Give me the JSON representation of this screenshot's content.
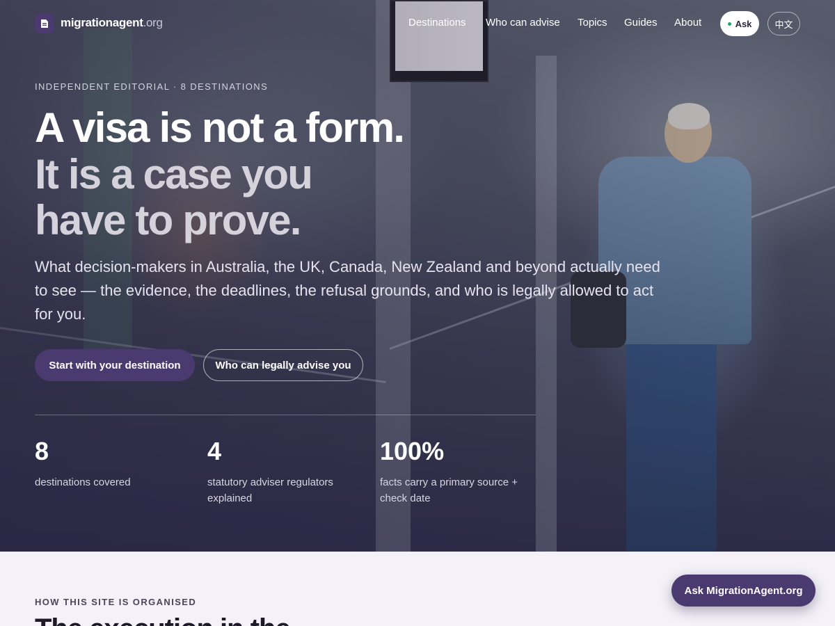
{
  "brand": {
    "name": "migrationagent",
    "tld": ".org"
  },
  "nav": {
    "items": [
      "Destinations",
      "Who can advise",
      "Topics",
      "Guides",
      "About"
    ],
    "ask_label": "Ask",
    "lang_label": "中文"
  },
  "hero": {
    "eyebrow": "INDEPENDENT EDITORIAL · 8 DESTINATIONS",
    "headline_line1": "A visa is not a form.",
    "headline_line2": "It is a case you",
    "headline_line3": "have to prove.",
    "lead": "What decision-makers in Australia, the UK, Canada, New Zealand and beyond actually need to see — the evidence, the deadlines, the refusal grounds, and who is legally allowed to act for you.",
    "primary_cta": "Start with your destination",
    "secondary_cta": "Who can legally advise you"
  },
  "stats": [
    {
      "value": "8",
      "label": "destinations covered"
    },
    {
      "value": "4",
      "label": "statutory adviser regulators explained"
    },
    {
      "value": "100%",
      "label": "facts carry a primary source + check date"
    }
  ],
  "section": {
    "eyebrow": "HOW THIS SITE IS ORGANISED",
    "heading": "The execution in the"
  },
  "floating": {
    "ask_label": "Ask MigrationAgent.org"
  },
  "colors": {
    "brand_purple": "#4b3a70",
    "page_bg": "#f4f2f8",
    "status_dot": "#27a36b"
  }
}
